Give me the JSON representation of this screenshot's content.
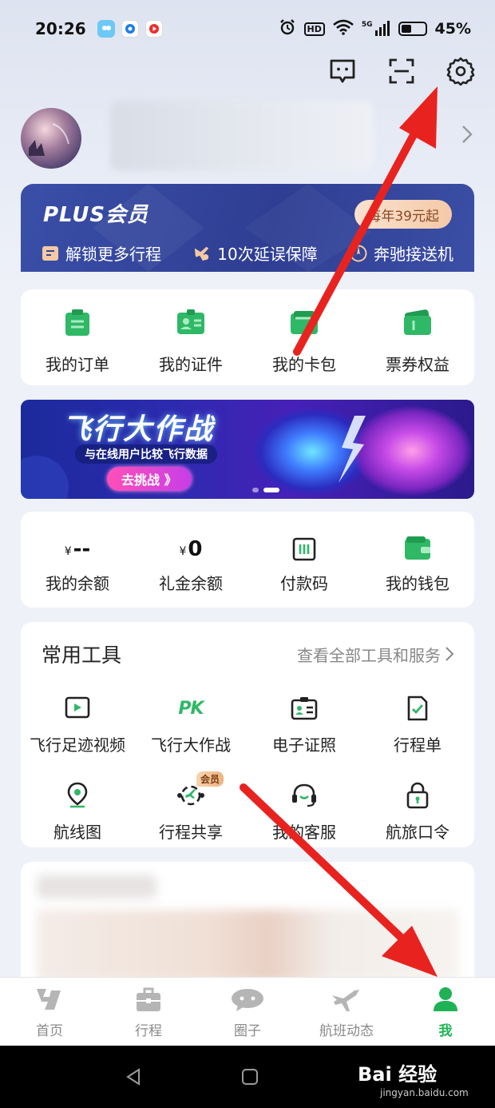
{
  "status": {
    "time": "20:26",
    "net": "5G",
    "battery_percent": "45%",
    "battery_level": 0.45,
    "hd": "HD"
  },
  "profile": {
    "chevron": "chevron-right-icon"
  },
  "plus": {
    "title": "PLUS会员",
    "price": "每年39元起",
    "perks": [
      {
        "label": "解锁更多行程",
        "icon": "ticket-icon"
      },
      {
        "label": "10次延误保障",
        "icon": "plane-shield-icon"
      },
      {
        "label": "奔驰接送机",
        "icon": "benz-icon"
      }
    ]
  },
  "quick": [
    {
      "label": "我的订单",
      "icon": "order-icon"
    },
    {
      "label": "我的证件",
      "icon": "id-card-icon"
    },
    {
      "label": "我的卡包",
      "icon": "card-pack-icon"
    },
    {
      "label": "票券权益",
      "icon": "coupon-icon"
    }
  ],
  "banner": {
    "title": "飞行大作战",
    "subtitle": "与在线用户比较飞行数据",
    "button": "去挑战 》"
  },
  "money": {
    "balance": {
      "currency": "¥",
      "value": "--",
      "label": "我的余额"
    },
    "gift": {
      "currency": "¥",
      "value": "0",
      "label": "礼金余额"
    },
    "paycode": {
      "label": "付款码"
    },
    "wallet": {
      "label": "我的钱包"
    }
  },
  "tools": {
    "title": "常用工具",
    "link": "查看全部工具和服务",
    "badge": "会员",
    "row1": [
      {
        "label": "飞行足迹视频",
        "icon": "video-icon"
      },
      {
        "label": "飞行大作战",
        "icon": "pk-icon",
        "glyph": "PK"
      },
      {
        "label": "电子证照",
        "icon": "e-license-icon"
      },
      {
        "label": "行程单",
        "icon": "itinerary-icon"
      }
    ],
    "row2": [
      {
        "label": "航线图",
        "icon": "map-pin-icon"
      },
      {
        "label": "行程共享",
        "icon": "share-trip-icon"
      },
      {
        "label": "我的客服",
        "icon": "headset-icon"
      },
      {
        "label": "航旅口令",
        "icon": "lock-icon"
      }
    ]
  },
  "tabs": [
    {
      "label": "首页",
      "icon": "home-icon"
    },
    {
      "label": "行程",
      "icon": "suitcase-icon"
    },
    {
      "label": "圈子",
      "icon": "chat-bubble-icon"
    },
    {
      "label": "航班动态",
      "icon": "plane-icon"
    },
    {
      "label": "我",
      "icon": "person-icon",
      "active": true
    }
  ],
  "watermark": {
    "text": "Bai 经验",
    "url": "jingyan.baidu.com"
  },
  "colors": {
    "green": "#1fb255",
    "plus_blue": "#33449c",
    "annotation_red": "#e8231f"
  }
}
